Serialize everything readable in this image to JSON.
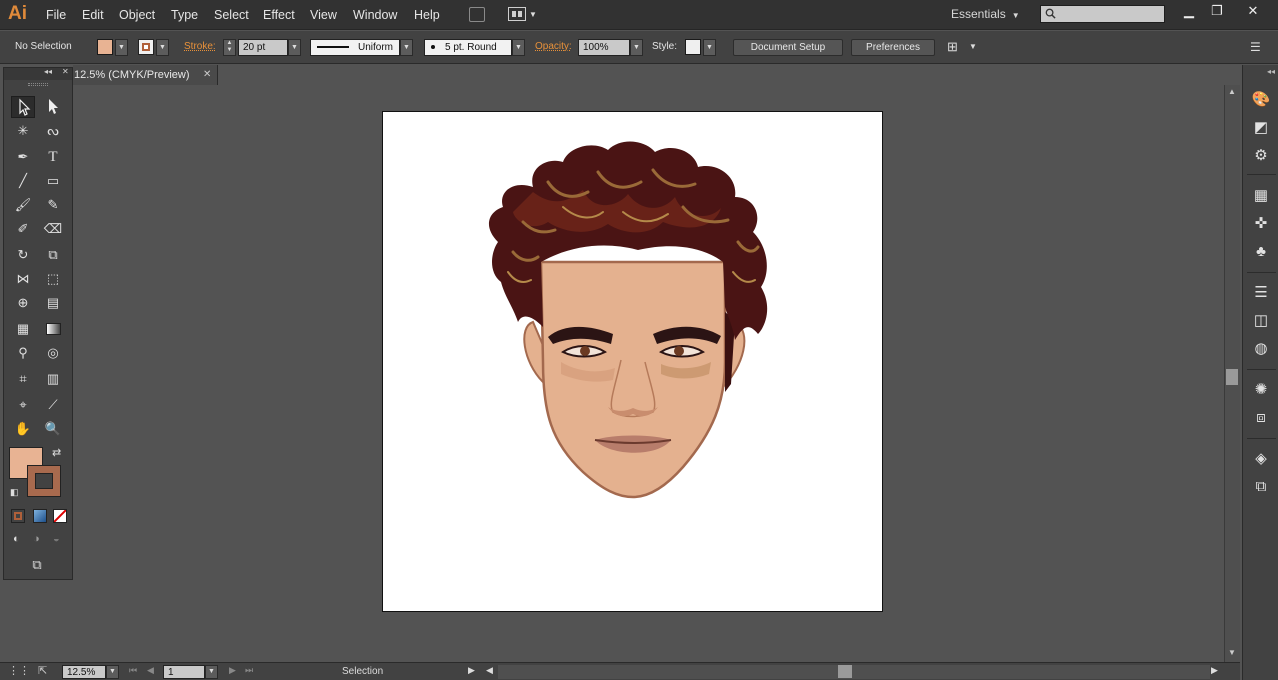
{
  "app": {
    "logo": "Ai"
  },
  "menu": [
    "File",
    "Edit",
    "Object",
    "Type",
    "Select",
    "Effect",
    "View",
    "Window",
    "Help"
  ],
  "workspace": {
    "label": "Essentials"
  },
  "control_bar": {
    "selection_status": "No Selection",
    "stroke_label": "Stroke:",
    "stroke_weight": "20 pt",
    "profile": "Uniform",
    "brush": "5 pt. Round",
    "opacity_label": "Opacity:",
    "opacity_value": "100%",
    "style_label": "Style:",
    "document_setup": "Document Setup",
    "preferences": "Preferences"
  },
  "document": {
    "tab_title": "12.5% (CMYK/Preview)"
  },
  "status_bar": {
    "zoom": "12.5%",
    "artboard_number": "1",
    "tool_status": "Selection"
  },
  "colors": {
    "fill": "#e8b393",
    "stroke_box": "#a86a4e",
    "accent_orange": "#e8913a",
    "skin": "#e4b18f",
    "hair": "#4a1414"
  },
  "tools": [
    "selection",
    "direct-selection",
    "magic-wand",
    "lasso",
    "pen",
    "type",
    "line-segment",
    "rectangle",
    "paintbrush",
    "pencil",
    "blob-brush",
    "eraser",
    "rotate",
    "scale",
    "width",
    "free-transform",
    "shape-builder",
    "perspective-grid",
    "mesh",
    "gradient",
    "eyedropper",
    "blend",
    "symbol-sprayer",
    "column-graph",
    "artboard",
    "slice",
    "hand",
    "zoom"
  ]
}
